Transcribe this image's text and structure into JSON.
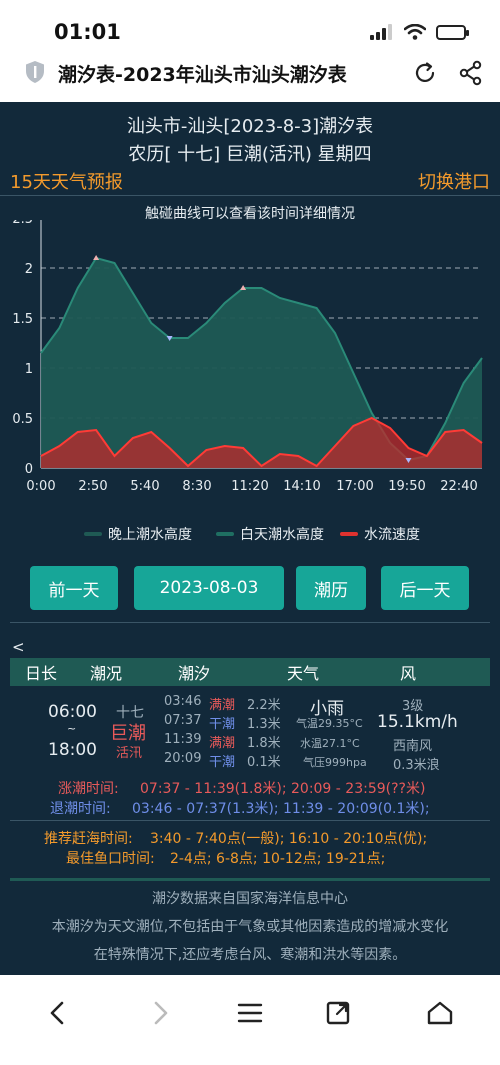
{
  "status": {
    "time": "01:01"
  },
  "browser": {
    "title": "潮汐表-2023年汕头市汕头潮汐表"
  },
  "header": {
    "line1": "汕头市-汕头[2023-8-3]潮汐表",
    "line2": "农历[ 十七] 巨潮(活汛) 星期四",
    "weather_link": "15天天气预报",
    "switch_port": "切换港口",
    "chart_hint": "触碰曲线可以查看该时间详细情况"
  },
  "chart_data": {
    "type": "area",
    "x": [
      "0:00",
      "1:00",
      "2:00",
      "3:00",
      "4:00",
      "5:00",
      "6:00",
      "7:00",
      "8:00",
      "9:00",
      "10:00",
      "11:00",
      "12:00",
      "13:00",
      "14:00",
      "15:00",
      "16:00",
      "17:00",
      "18:00",
      "19:00",
      "20:00",
      "21:00",
      "22:00",
      "23:00"
    ],
    "x_ticks": [
      "0:00",
      "2:50",
      "5:40",
      "8:30",
      "11:20",
      "14:10",
      "17:00",
      "19:50",
      "22:40"
    ],
    "y_ticks": [
      "0",
      "0.5",
      "1",
      "1.5",
      "2",
      "2.5"
    ],
    "ylim": [
      0,
      2.5
    ],
    "series": [
      {
        "name": "晚上潮水高度",
        "color": "#1f5a54",
        "values": [
          1.15,
          1.4,
          1.8,
          2.1,
          2.05,
          1.75,
          1.45,
          1.3,
          1.3,
          1.45,
          1.65,
          1.8,
          1.8,
          1.7,
          1.65,
          1.6,
          1.35,
          0.95,
          0.55,
          0.25,
          0.08,
          0.12,
          0.45,
          0.85,
          1.1
        ]
      },
      {
        "name": "白天潮水高度",
        "color": "#1f6f62",
        "values": []
      },
      {
        "name": "水流速度",
        "color": "#e0322f",
        "values": [
          0.12,
          0.22,
          0.36,
          0.38,
          0.12,
          0.3,
          0.36,
          0.2,
          0.02,
          0.18,
          0.22,
          0.2,
          0.02,
          0.14,
          0.12,
          0.02,
          0.22,
          0.42,
          0.5,
          0.4,
          0.2,
          0.12,
          0.36,
          0.38,
          0.25
        ]
      }
    ],
    "grid": true,
    "legend": "bottom"
  },
  "legend": {
    "night": "晚上潮水高度",
    "day": "白天潮水高度",
    "speed": "水流速度"
  },
  "nav": {
    "prev": "前一天",
    "date": "2023-08-03",
    "tide_cal": "潮历",
    "next": "后一天"
  },
  "lt": "<",
  "table": {
    "headers": [
      "日长",
      "潮况",
      "潮汐",
      "天气",
      "风"
    ],
    "sunrise": "06:00",
    "tilde": "~",
    "sunset": "18:00",
    "lunar": "十七",
    "tide_type": "巨潮",
    "tide_sub": "活汛",
    "tides": [
      {
        "time": "03:46",
        "type": "满潮",
        "height": "2.2米",
        "kind": "high"
      },
      {
        "time": "07:37",
        "type": "干潮",
        "height": "1.3米",
        "kind": "low"
      },
      {
        "time": "11:39",
        "type": "满潮",
        "height": "1.8米",
        "kind": "high"
      },
      {
        "time": "20:09",
        "type": "干潮",
        "height": "0.1米",
        "kind": "low"
      }
    ],
    "weather": "小雨",
    "air_temp": "气温29.35°C",
    "water_temp": "水温27.1°C",
    "pressure": "气压999hpa",
    "wind_level": "3级",
    "wind_speed": "15.1km/h",
    "wind_dir": "西南风",
    "wave": "0.3米浪"
  },
  "times": {
    "rise_label": "涨潮时间:",
    "rise_value": "07:37 - 11:39(1.8米); 20:09 - 23:59(??米)",
    "fall_label": "退潮时间:",
    "fall_value": "03:46 - 07:37(1.3米); 11:39 - 20:09(0.1米);",
    "sea_label": "推荐赶海时间:",
    "sea_value": "3:40 - 7:40点(一般); 16:10 - 20:10点(优);",
    "fish_label": "最佳鱼口时间:",
    "fish_value": "2-4点; 6-8点; 10-12点; 19-21点;"
  },
  "footer": {
    "source": "潮汐数据来自国家海洋信息中心",
    "note1": "本潮汐为天文潮位,不包括由于气象或其他因素造成的增减水变化",
    "note2": "在特殊情况下,还应考虑台风、寒潮和洪水等因素。"
  }
}
